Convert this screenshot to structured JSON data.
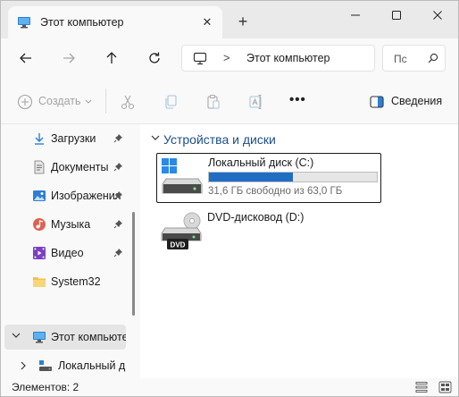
{
  "window": {
    "tab_title": "Этот компьютер",
    "tab_close": "✕",
    "new_tab": "+"
  },
  "address": {
    "separator": ">",
    "path": "Этот компьютер",
    "search_placeholder": "Пс"
  },
  "commands": {
    "create_label": "Создать",
    "more_label": "•••",
    "details_label": "Сведения"
  },
  "sidebar": {
    "items": [
      {
        "label": "Загрузки",
        "icon": "download-icon"
      },
      {
        "label": "Документы",
        "icon": "documents-icon"
      },
      {
        "label": "Изображения",
        "icon": "pictures-icon"
      },
      {
        "label": "Музыка",
        "icon": "music-icon"
      },
      {
        "label": "Видео",
        "icon": "video-icon"
      },
      {
        "label": "System32",
        "icon": "folder-icon"
      },
      {
        "label": "Этот компьютер",
        "icon": "computer-icon"
      },
      {
        "label": "Локальный диск",
        "icon": "drive-icon"
      }
    ]
  },
  "content": {
    "group_title": "Устройства и диски",
    "drives": [
      {
        "name": "Локальный диск (C:)",
        "free_text": "31,6 ГБ свободно из 63,0 ГБ",
        "used_fraction": 0.498,
        "icon": "system-drive-icon"
      },
      {
        "name": "DVD-дисковод (D:)",
        "icon": "dvd-drive-icon",
        "badge": "DVD"
      }
    ]
  },
  "status": {
    "items_text": "Элементов: 2"
  },
  "colors": {
    "accent": "#1f6dc4",
    "group_title": "#1b4f8a"
  }
}
